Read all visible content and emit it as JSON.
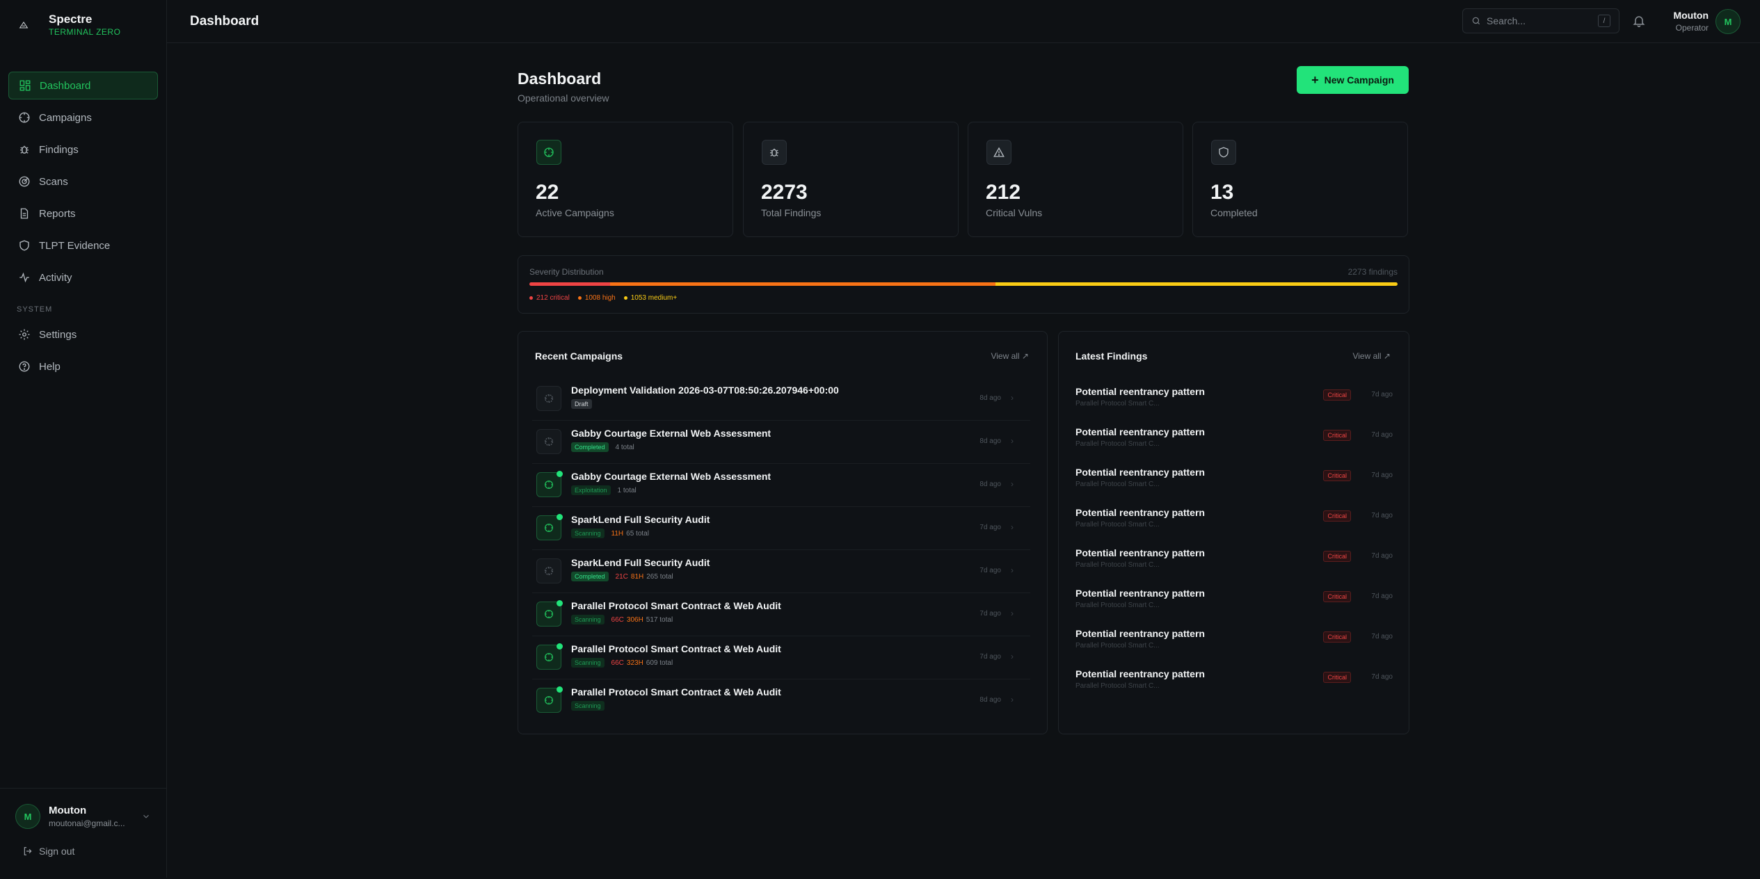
{
  "brand": {
    "name": "Spectre",
    "subtitle": "TERMINAL ZERO"
  },
  "nav": {
    "items": [
      {
        "label": "Dashboard",
        "icon": "grid-icon"
      },
      {
        "label": "Campaigns",
        "icon": "crosshair-icon"
      },
      {
        "label": "Findings",
        "icon": "bug-icon"
      },
      {
        "label": "Scans",
        "icon": "radar-icon"
      },
      {
        "label": "Reports",
        "icon": "file-icon"
      },
      {
        "label": "TLPT Evidence",
        "icon": "shield-icon"
      },
      {
        "label": "Activity",
        "icon": "activity-icon"
      }
    ],
    "section_label": "SYSTEM",
    "system_items": [
      {
        "label": "Settings",
        "icon": "gear-icon"
      },
      {
        "label": "Help",
        "icon": "help-icon"
      }
    ]
  },
  "sidebar_user": {
    "initial": "M",
    "name": "Mouton",
    "email": "moutonai@gmail.c...",
    "signout": "Sign out"
  },
  "topbar": {
    "title": "Dashboard",
    "search_placeholder": "Search...",
    "search_shortcut": "/",
    "user_name": "Mouton",
    "user_role": "Operator",
    "user_initial": "M"
  },
  "header": {
    "title": "Dashboard",
    "subtitle": "Operational overview",
    "new_button": "New Campaign"
  },
  "stats": [
    {
      "value": "22",
      "label": "Active Campaigns",
      "icon": "crosshair-icon"
    },
    {
      "value": "2273",
      "label": "Total Findings",
      "icon": "bug-icon"
    },
    {
      "value": "212",
      "label": "Critical Vulns",
      "icon": "alert-triangle-icon"
    },
    {
      "value": "13",
      "label": "Completed",
      "icon": "shield-icon"
    }
  ],
  "severity": {
    "title": "Severity Distribution",
    "total": "2273 findings",
    "legend": [
      "212 critical",
      "1008 high",
      "1053 medium+"
    ],
    "counts": {
      "critical": 212,
      "high": 1008,
      "medium": 1053
    },
    "colors": {
      "critical": "#ef4444",
      "high": "#f97316",
      "medium": "#facc15"
    }
  },
  "recent_campaigns": {
    "title": "Recent Campaigns",
    "view_all": "View all ↗",
    "rows": [
      {
        "name": "Deployment Validation 2026-03-07T08:50:26.207946+00:00",
        "status": "Draft",
        "crit": "",
        "high": "",
        "total": "",
        "time": "8d ago",
        "live": false
      },
      {
        "name": "Gabby Courtage External Web Assessment",
        "status": "Completed",
        "crit": "",
        "high": "",
        "total": "4 total",
        "time": "8d ago",
        "live": false
      },
      {
        "name": "Gabby Courtage External Web Assessment",
        "status": "Exploitation",
        "crit": "",
        "high": "",
        "total": "1 total",
        "time": "8d ago",
        "live": true
      },
      {
        "name": "SparkLend Full Security Audit",
        "status": "Scanning",
        "crit": "",
        "high": "11H",
        "total": "65 total",
        "time": "7d ago",
        "live": true
      },
      {
        "name": "SparkLend Full Security Audit",
        "status": "Completed",
        "crit": "21C",
        "high": "81H",
        "total": "265 total",
        "time": "7d ago",
        "live": false
      },
      {
        "name": "Parallel Protocol Smart Contract & Web Audit",
        "status": "Scanning",
        "crit": "66C",
        "high": "306H",
        "total": "517 total",
        "time": "7d ago",
        "live": true
      },
      {
        "name": "Parallel Protocol Smart Contract & Web Audit",
        "status": "Scanning",
        "crit": "66C",
        "high": "323H",
        "total": "609 total",
        "time": "7d ago",
        "live": true
      },
      {
        "name": "Parallel Protocol Smart Contract & Web Audit",
        "status": "Scanning",
        "crit": "",
        "high": "",
        "total": "",
        "time": "8d ago",
        "live": true
      }
    ]
  },
  "latest_findings": {
    "title": "Latest Findings",
    "view_all": "View all ↗",
    "rows": [
      {
        "name": "Potential reentrancy pattern",
        "sub": "Parallel Protocol Smart C...",
        "severity": "Critical",
        "time": "7d ago"
      },
      {
        "name": "Potential reentrancy pattern",
        "sub": "Parallel Protocol Smart C...",
        "severity": "Critical",
        "time": "7d ago"
      },
      {
        "name": "Potential reentrancy pattern",
        "sub": "Parallel Protocol Smart C...",
        "severity": "Critical",
        "time": "7d ago"
      },
      {
        "name": "Potential reentrancy pattern",
        "sub": "Parallel Protocol Smart C...",
        "severity": "Critical",
        "time": "7d ago"
      },
      {
        "name": "Potential reentrancy pattern",
        "sub": "Parallel Protocol Smart C...",
        "severity": "Critical",
        "time": "7d ago"
      },
      {
        "name": "Potential reentrancy pattern",
        "sub": "Parallel Protocol Smart C...",
        "severity": "Critical",
        "time": "7d ago"
      },
      {
        "name": "Potential reentrancy pattern",
        "sub": "Parallel Protocol Smart C...",
        "severity": "Critical",
        "time": "7d ago"
      },
      {
        "name": "Potential reentrancy pattern",
        "sub": "Parallel Protocol Smart C...",
        "severity": "Critical",
        "time": "7d ago"
      }
    ]
  }
}
